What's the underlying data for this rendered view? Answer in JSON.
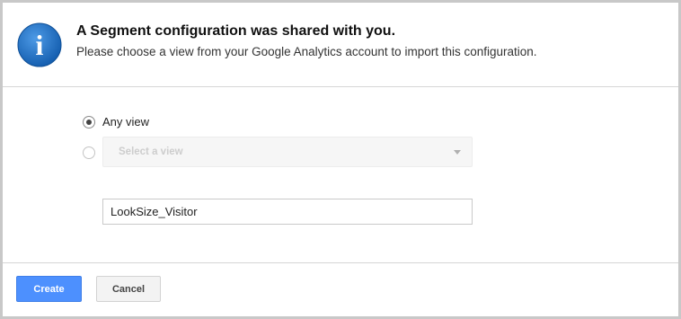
{
  "header": {
    "icon": "info-icon",
    "icon_glyph": "i",
    "title": "A Segment configuration was shared with you.",
    "subtitle": "Please choose a view from your Google Analytics account to import this configuration."
  },
  "view_options": {
    "any_view": {
      "label": "Any view",
      "selected": true
    },
    "specific_view": {
      "selected": false,
      "placeholder": "Select a view"
    }
  },
  "segment_name": {
    "value": "LookSize_Visitor"
  },
  "buttons": {
    "create": "Create",
    "cancel": "Cancel"
  },
  "colors": {
    "primary_button": "#4d90fe",
    "info_icon": "#1f6cc0"
  }
}
